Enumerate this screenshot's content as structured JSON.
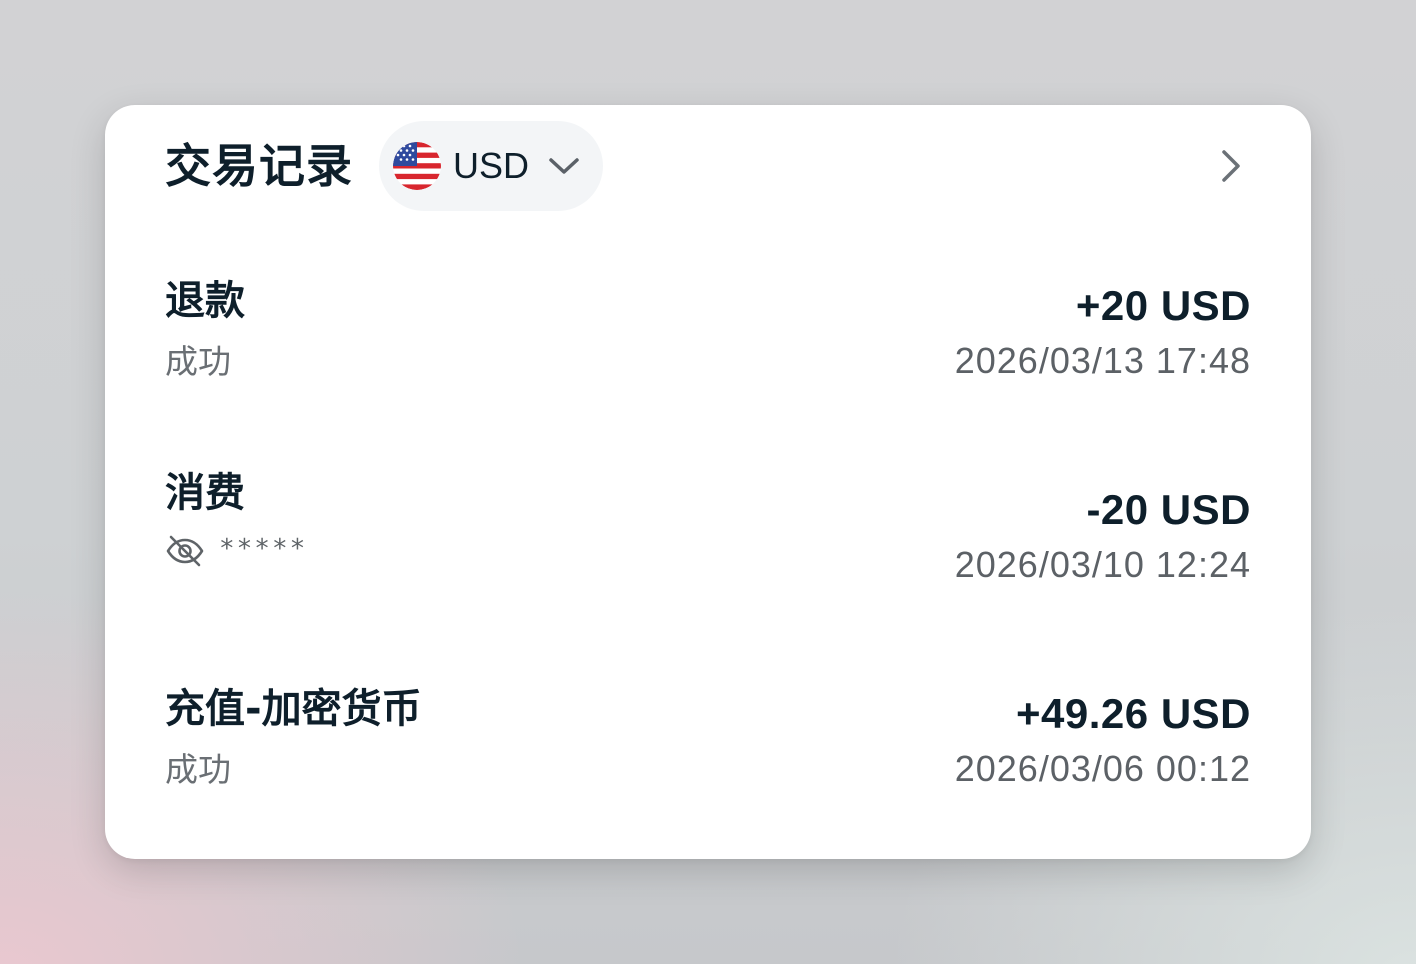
{
  "header": {
    "title": "交易记录",
    "currency": {
      "selected": "USD",
      "flag_icon": "us-flag-icon",
      "dropdown_icon": "chevron-down-icon"
    },
    "nav_icon": "chevron-right-icon"
  },
  "transactions": [
    {
      "title": "退款",
      "status": "成功",
      "amount": "+20 USD",
      "time": "2026/03/13 17:48"
    },
    {
      "title": "消费",
      "masked_value": "*****",
      "masked_icon": "eye-off-icon",
      "amount": "-20 USD",
      "time": "2026/03/10 12:24"
    },
    {
      "title": "充值-加密货币",
      "status": "成功",
      "amount": "+49.26 USD",
      "time": "2026/03/06 00:12"
    }
  ],
  "colors": {
    "text_primary": "#0e1f2b",
    "text_secondary": "#6a6f74",
    "pill_background": "#f3f5f7",
    "card_background": "#ffffff"
  }
}
